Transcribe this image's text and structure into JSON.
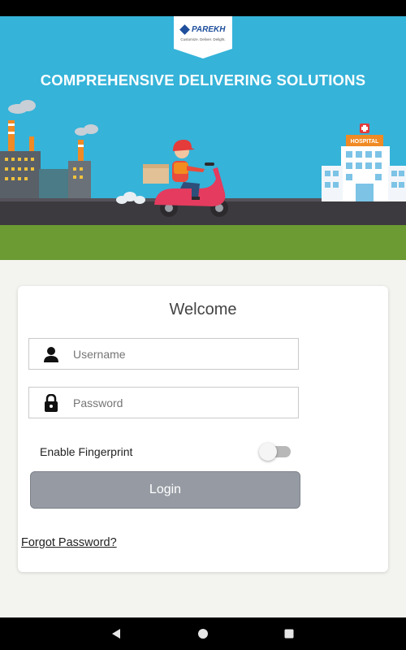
{
  "hero": {
    "brand": "PAREKH",
    "tagline": "Customize. Deliver. Delight.",
    "title": "COMPREHENSIVE DELIVERING SOLUTIONS",
    "hospital_sign": "HOSPITAL"
  },
  "login": {
    "welcome": "Welcome",
    "username_placeholder": "Username",
    "password_placeholder": "Password",
    "fingerprint_label": "Enable Fingerprint",
    "fingerprint_enabled": false,
    "login_label": "Login",
    "forgot_label": "Forgot Password?"
  },
  "icons": {
    "username": "person-icon",
    "password": "lock-icon",
    "nav_back": "back-triangle-icon",
    "nav_home": "home-circle-icon",
    "nav_recents": "recents-square-icon"
  },
  "colors": {
    "hero_sky": "#35b3d9",
    "ground": "#6c9a33",
    "login_button": "#969ba3",
    "scooter": "#e43b5e"
  }
}
